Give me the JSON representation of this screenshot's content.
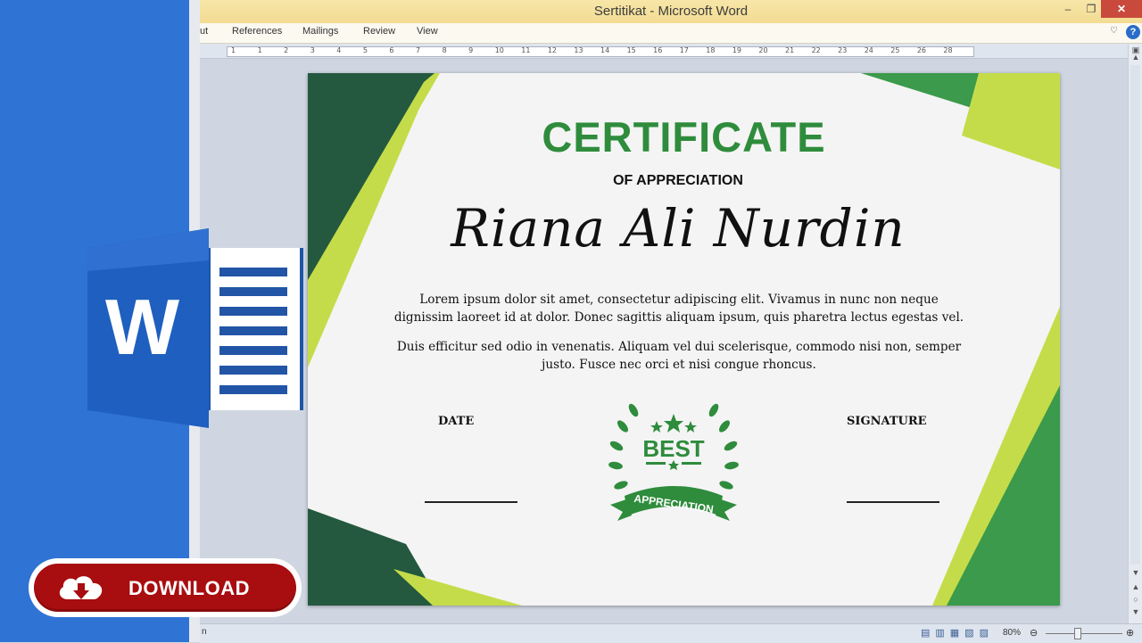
{
  "window": {
    "title": "Sertitikat  -  Microsoft Word",
    "minimize": "–",
    "restore": "❐",
    "close": "✕"
  },
  "ribbon": {
    "tabs": [
      "ut",
      "References",
      "Mailings",
      "Review",
      "View"
    ]
  },
  "ruler": {
    "numbers": [
      "1",
      "1",
      "2",
      "3",
      "4",
      "5",
      "6",
      "7",
      "8",
      "9",
      "10",
      "11",
      "12",
      "13",
      "14",
      "15",
      "16",
      "17",
      "18",
      "19",
      "20",
      "21",
      "22",
      "23",
      "24",
      "25",
      "26",
      "28"
    ]
  },
  "statusbar": {
    "left_text": "n",
    "zoom": "80%"
  },
  "promo": {
    "download_label": "DOWNLOAD",
    "logo_letter": "W"
  },
  "certificate": {
    "heading": "CERTIFICATE",
    "subheading": "OF APPRECIATION",
    "recipient": "Riana Ali Nurdin",
    "paragraph1": "Lorem ipsum dolor sit amet, consectetur adipiscing elit. Vivamus in nunc non neque dignissim laoreet id at dolor. Donec sagittis aliquam ipsum, quis pharetra lectus egestas vel.",
    "paragraph2": "Duis efficitur sed odio in venenatis. Aliquam vel dui scelerisque, commodo nisi non, semper justo. Fusce nec orci et nisi congue rhoncus.",
    "date_label": "DATE",
    "signature_label": "SIGNATURE",
    "badge_top": "BEST",
    "badge_ribbon": "APPRECIATION"
  },
  "colors": {
    "dark_green": "#24593f",
    "green": "#3b9a4b",
    "lime": "#c5dc4a",
    "word_blue": "#2f73d4",
    "download_red": "#a80d10"
  }
}
